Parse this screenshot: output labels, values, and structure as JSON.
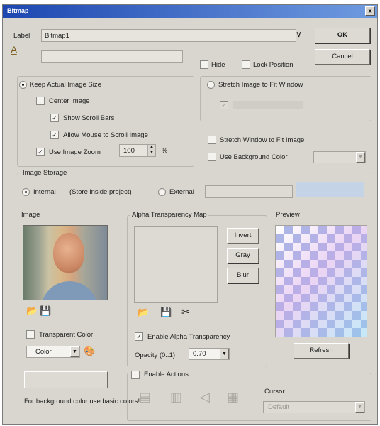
{
  "window": {
    "title": "Bitmap",
    "close_glyph": "x"
  },
  "top": {
    "label_caption": "Label",
    "label_value": "Bitmap1",
    "ok": "OK",
    "cancel": "Cancel",
    "hide": "Hide",
    "lock_position": "Lock Position"
  },
  "size_group": {
    "keep_actual": "Keep Actual Image Size",
    "center_image": "Center Image",
    "show_scroll_bars": "Show Scroll Bars",
    "allow_mouse_scroll": "Allow Mouse to Scroll Image",
    "use_image_zoom": "Use Image Zoom",
    "zoom_value": "100",
    "zoom_unit": "%",
    "stretch_to_fit": "Stretch Image to Fit Window",
    "stretch_window": "Stretch Window to Fit Image",
    "use_background_color": "Use Background Color"
  },
  "storage": {
    "heading": "Image Storage",
    "internal": "Internal",
    "internal_note": "(Store inside project)",
    "external": "External"
  },
  "image": {
    "heading": "Image",
    "transparent_color": "Transparent Color",
    "color_select": "Color",
    "note": "For background color use basic colors!"
  },
  "alpha": {
    "heading": "Alpha Transparency Map",
    "invert": "Invert",
    "gray": "Gray",
    "blur": "Blur",
    "enable_alpha": "Enable Alpha Transparency",
    "opacity_label": "Opacity (0..1)",
    "opacity_value": "0.70"
  },
  "preview": {
    "heading": "Preview",
    "refresh": "Refresh"
  },
  "actions": {
    "enable_actions": "Enable Actions",
    "cursor_label": "Cursor",
    "cursor_value": "Default"
  }
}
